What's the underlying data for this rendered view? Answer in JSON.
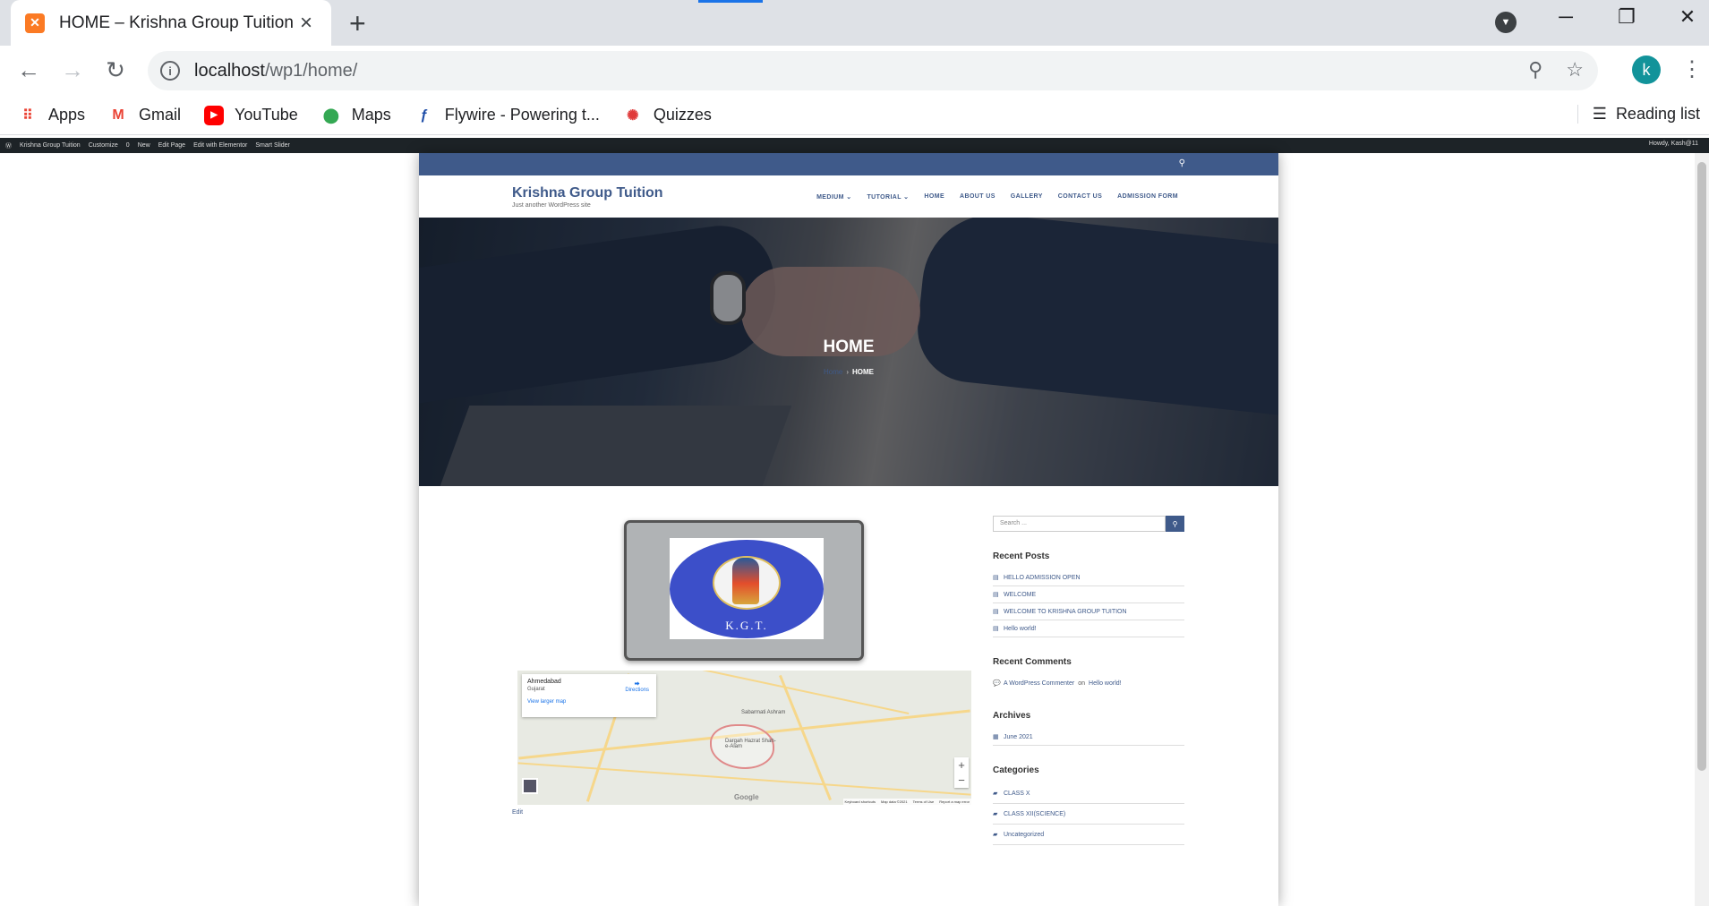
{
  "browser": {
    "tab_title": "HOME – Krishna Group Tuition",
    "tab_favicon": "XAMPP",
    "url_host": "localhost",
    "url_path": "/wp1/home/",
    "profile_initial": "k",
    "reading_list": "Reading list"
  },
  "bookmarks": [
    {
      "label": "Apps",
      "icon": "apps-grid-icon"
    },
    {
      "label": "Gmail",
      "icon": "gmail-icon"
    },
    {
      "label": "YouTube",
      "icon": "youtube-icon"
    },
    {
      "label": "Maps",
      "icon": "maps-pin-icon"
    },
    {
      "label": "Flywire - Powering t...",
      "icon": "flywire-icon"
    },
    {
      "label": "Quizzes",
      "icon": "quizzes-icon"
    }
  ],
  "wpbar": {
    "site": "Krishna Group Tuition",
    "customize": "Customize",
    "comments": "0",
    "new": "New",
    "edit_page": "Edit Page",
    "elementor": "Edit with Elementor",
    "slider": "Smart Slider",
    "howdy": "Howdy, Kash@11"
  },
  "site": {
    "title": "Krishna Group Tuition",
    "tagline": "Just another WordPress site",
    "menu": [
      "MEDIUM ⌄",
      "TUTORIAL ⌄",
      "HOME",
      "ABOUT US",
      "GALLERY",
      "CONTACT US",
      "ADMISSION FORM"
    ],
    "hero_title": "HOME",
    "breadcrumb_home": "Home",
    "breadcrumb_current": "HOME",
    "logo_text": "K.G.T.",
    "edit_link": "Edit"
  },
  "map": {
    "place": "Ahmedabad",
    "region": "Gujarat",
    "directions": "Directions",
    "larger": "View larger map",
    "labels": [
      "Sabarmati Ashram",
      "Dargah Hazrat Shah-e-Alam"
    ],
    "footer": [
      "Keyboard shortcuts",
      "Map data ©2021",
      "Terms of Use",
      "Report a map error"
    ],
    "brand": "Google"
  },
  "sidebar": {
    "search_placeholder": "Search ...",
    "recent_posts_title": "Recent Posts",
    "recent_posts": [
      "HELLO ADMISSION OPEN",
      "WELCOME",
      "WELCOME TO KRISHNA GROUP TUITION",
      "Hello world!"
    ],
    "recent_comments_title": "Recent Comments",
    "comment_author": "A WordPress Commenter",
    "comment_on": "on",
    "comment_post": "Hello world!",
    "archives_title": "Archives",
    "archives": [
      "June 2021"
    ],
    "categories_title": "Categories",
    "categories": [
      "CLASS X",
      "CLASS XII(SCIENCE)",
      "Uncategorized"
    ]
  }
}
